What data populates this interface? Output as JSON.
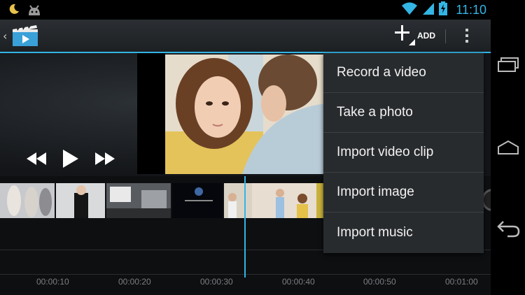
{
  "status_bar": {
    "time": "11:10",
    "icons": [
      "moon-icon",
      "android-icon",
      "wifi-icon",
      "signal-icon",
      "battery-charging-icon"
    ]
  },
  "action_bar": {
    "add_label": "ADD",
    "icons": [
      "app-clapperboard-icon",
      "plus-icon",
      "overflow-menu-icon"
    ]
  },
  "playback": {
    "icons": [
      "rewind-icon",
      "play-icon",
      "fast-forward-icon"
    ]
  },
  "menu": {
    "items": [
      {
        "label": "Record a video"
      },
      {
        "label": "Take a photo"
      },
      {
        "label": "Import video clip"
      },
      {
        "label": "Import image"
      },
      {
        "label": "Import music"
      }
    ]
  },
  "timeline": {
    "ticks": [
      "00:00:10",
      "00:00:20",
      "00:00:30",
      "00:00:40",
      "00:00:50",
      "00:01:00"
    ]
  },
  "navigation": {
    "icons": [
      "recent-apps-icon",
      "home-icon",
      "back-icon"
    ]
  },
  "colors": {
    "accent": "#33b5e5",
    "menu_background": "#282b2e",
    "background": "#0b0b0d"
  }
}
